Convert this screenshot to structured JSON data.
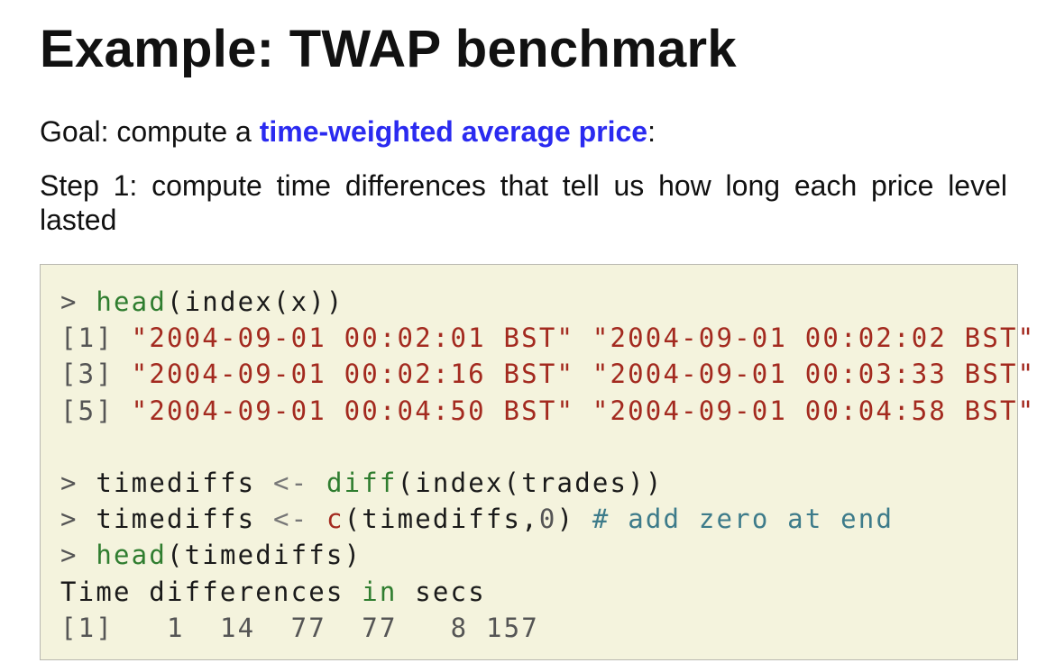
{
  "slide": {
    "title": "Example: TWAP benchmark",
    "goal": {
      "prefix": "Goal: compute a ",
      "highlight": "time-weighted average price",
      "suffix": ":"
    },
    "step1": "Step 1: compute time differences that tell us how long each price level lasted"
  },
  "code": {
    "line1": {
      "prompt": ">",
      "fn": "head",
      "rest": "(index(x))"
    },
    "line2": {
      "index": "[1]",
      "values": [
        "\"2004-09-01 00:02:01 BST\"",
        "\"2004-09-01 00:02:02 BST\""
      ]
    },
    "line3": {
      "index": "[3]",
      "values": [
        "\"2004-09-01 00:02:16 BST\"",
        "\"2004-09-01 00:03:33 BST\""
      ]
    },
    "line4": {
      "index": "[5]",
      "values": [
        "\"2004-09-01 00:04:50 BST\"",
        "\"2004-09-01 00:04:58 BST\""
      ]
    },
    "line5": {
      "prompt": ">",
      "var": "timediffs",
      "assign": "<-",
      "fn": "diff",
      "rest": "(index(trades))"
    },
    "line6": {
      "prompt": ">",
      "var": "timediffs",
      "assign": "<-",
      "fn": "c",
      "args": "(timediffs,",
      "num": "0",
      "close": ")",
      "comment": "# add zero at end"
    },
    "line7": {
      "prompt": ">",
      "fn": "head",
      "rest": "(timediffs)"
    },
    "line8": {
      "text1": "Time differences",
      "kw": "in",
      "text2": "secs"
    },
    "line9": {
      "index": "[1]",
      "values": [
        "1",
        "14",
        "77",
        "77",
        "8",
        "157"
      ]
    }
  }
}
